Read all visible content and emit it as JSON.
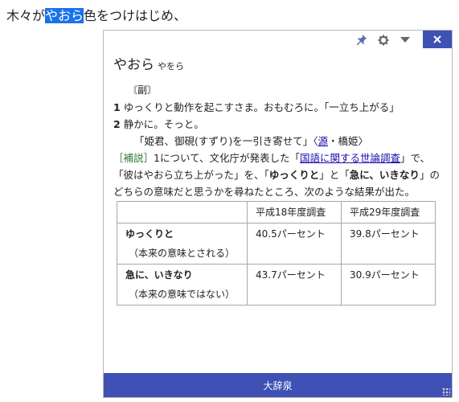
{
  "sentence": {
    "before": "木々が",
    "selected": "やおら",
    "after": "色をつけはじめ、"
  },
  "popup": {
    "headword": "やおら",
    "reading": "やをら",
    "pos": "〘副〙",
    "defs": [
      {
        "num": "1",
        "text": "ゆっくりと動作を起こすさま。おもむろに。「一立ち上がる」"
      },
      {
        "num": "2",
        "text": "静かに。そっと。"
      }
    ],
    "quote": {
      "text": "「姫君、御硯(すずり)を一引き寄せて」〈",
      "src": "源",
      "rest": "・橋姫〉"
    },
    "note": {
      "tag": "［補説］",
      "p1": "1について、文化庁が発表した「",
      "link": "国語に関する世論調査",
      "p2": "」で、「彼はやおら立ち上がった」を、「",
      "b1": "ゆっくりと",
      "p3": "」と「",
      "b2": "急に、いきなり",
      "p4": "」のどちらの意味だと思うかを尋ねたところ、次のような結果が出た。"
    },
    "table": {
      "headers": [
        "",
        "平成18年度調査",
        "平成29年度調査"
      ],
      "rows": [
        {
          "label": "ゆっくりと",
          "sub": "（本来の意味とされる）",
          "v1": "40.5パーセント",
          "v2": "39.8パーセント"
        },
        {
          "label": "急に、いきなり",
          "sub": "（本来の意味ではない）",
          "v1": "43.7パーセント",
          "v2": "30.9パーセント"
        }
      ]
    },
    "footer": "大辞泉",
    "icons": {
      "pin": "pin-icon",
      "gear": "gear-icon",
      "chevron": "chevron-down-icon",
      "close": "close-icon"
    }
  }
}
